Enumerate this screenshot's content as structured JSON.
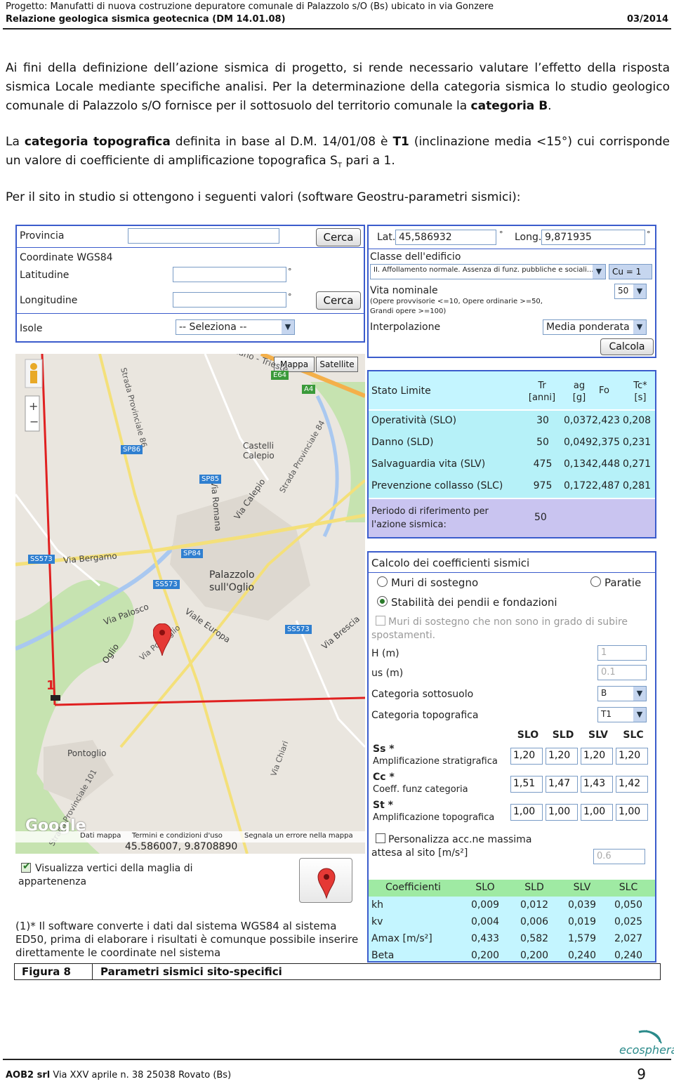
{
  "header": {
    "project": "Progetto: Manufatti di nuova costruzione depuratore comunale di Palazzolo s/O (Bs) ubicato in via Gonzere",
    "report": "Relazione geologica sismica geotecnica (DM 14.01.08)",
    "date": "03/2014"
  },
  "paragraphs": {
    "p1": "Ai fini della definizione dell’azione sismica di progetto, si rende necessario valutare l’effetto della risposta sismica  Locale mediante specifiche analisi. Per la determinazione della categoria sismica lo studio geologico comunale di Palazzolo s/O fornisce per il sottosuolo del territorio comunale la ",
    "p1_bold": "categoria B",
    "p1_end": ".",
    "p2_a": "La ",
    "p2_bold1": "categoria topografica",
    "p2_b": " definita in base al D.M. 14/01/08 è ",
    "p2_bold2": "T1",
    "p2_c": " (inclinazione media <15°) cui corrisponde un valore di coefficiente di amplificazione topografica S",
    "p2_sub": "T",
    "p2_d": " pari a 1.",
    "p3": "Per il sito in studio si ottengono i seguenti valori (software Geostru-parametri sismici):"
  },
  "search": {
    "provincia": "Provincia",
    "cerca": "Cerca",
    "coord": "Coordinate WGS84",
    "latitudine": "Latitudine",
    "longitudine": "Longitudine",
    "deg": "°",
    "isole": "Isole",
    "isole_sel": "-- Seleziona --"
  },
  "site": {
    "lat_label": "Lat.",
    "lat": "45,586932",
    "long_label": "Long.",
    "long": "9,871935",
    "deg": "°",
    "classe_label": "Classe dell'edificio",
    "classe_sel": "II. Affollamento normale. Assenza di funz. pubbliche e sociali...",
    "cu": "Cu = 1",
    "vita_label": "Vita nominale",
    "vita_note1": "(Opere provvisorie <=10, Opere ordinarie >=50,",
    "vita_note2": "Grandi opere >=100)",
    "vita_sel": "50",
    "interp_label": "Interpolazione",
    "interp_sel": "Media ponderata",
    "calcola": "Calcola"
  },
  "map": {
    "btn_mappa": "Mappa",
    "btn_sat": "Satellite",
    "coords": "45.586007, 9.8708890",
    "google": "Google",
    "dati": "Dati mappa",
    "termini": "Termini e condizioni d'uso",
    "segnala": "Segnala un errore nella mappa",
    "marker": "1",
    "places": {
      "castelli": "Castelli Calepio",
      "palazzolo": "Palazzolo sull'Oglio",
      "pontoglio": "Pontoglio",
      "bergamo": "Via Bergamo",
      "palosco": "Via Palosco",
      "europa": "Viale Europa",
      "brescia": "Via Brescia",
      "calepio": "Via Calepio",
      "romana": "Via Romana",
      "oglio": "Oglio",
      "milano_trieste": "Milano - Trieste",
      "sp86": "Strada Provinciale 86",
      "sp84": "Strada Provinciale 84",
      "sp101": "Strada Provinciale 101",
      "chiari": "Via Chiari",
      "pontoglio_via": "Via Pontoglio"
    },
    "shields": [
      "E64",
      "A4",
      "SP86",
      "SP85",
      "SP84",
      "SS573",
      "SS573",
      "SS573"
    ]
  },
  "visualizza": "Visualizza vertici della maglia di appartenenza",
  "footnote": "(1)* Il software converte i dati dal sistema WGS84 al sistema ED50, prima di elaborare i risultati è comunque possibile inserire direttamente le coordinate nel sistema",
  "limits": {
    "headers": [
      "Stato Limite",
      "Tr [anni]",
      "ag [g]",
      "Fo",
      "Tc* [s]"
    ],
    "rows": [
      [
        "Operatività (SLO)",
        "30",
        "0,037",
        "2,423",
        "0,208"
      ],
      [
        "Danno (SLD)",
        "50",
        "0,049",
        "2,375",
        "0,231"
      ],
      [
        "Salvaguardia vita (SLV)",
        "475",
        "0,134",
        "2,448",
        "0,271"
      ],
      [
        "Prevenzione collasso (SLC)",
        "975",
        "0,172",
        "2,487",
        "0,281"
      ]
    ],
    "periodo_label": "Periodo di riferimento per l'azione sismica:",
    "periodo": "50"
  },
  "coeff": {
    "title": "Calcolo dei coefficienti sismici",
    "muri": "Muri di sostegno",
    "paratie": "Paratie",
    "stab": "Stabilità dei pendii e fondazioni",
    "muri2": "Muri di sostegno che non sono in grado di subire spostamenti.",
    "h": "H (m)",
    "h_val": "1",
    "us": "us (m)",
    "us_val": "0.1",
    "cat_sott": "Categoria sottosuolo",
    "cat_sott_val": "B",
    "cat_top": "Categoria topografica",
    "cat_top_val": "T1",
    "cols": [
      "SLO",
      "SLD",
      "SLV",
      "SLC"
    ],
    "ss_label": "Ss *",
    "ss_desc": "Amplificazione stratigrafica",
    "ss": [
      "1,20",
      "1,20",
      "1,20",
      "1,20"
    ],
    "cc_label": "Cc *",
    "cc_desc": "Coeff. funz categoria",
    "cc": [
      "1,51",
      "1,47",
      "1,43",
      "1,42"
    ],
    "st_label": "St *",
    "st_desc": "Amplificazione topografica",
    "st": [
      "1,00",
      "1,00",
      "1,00",
      "1,00"
    ],
    "pers": "Personalizza acc.ne massima attesa al sito [m/s²]",
    "pers_val": "0.6",
    "tbl_headers": [
      "Coefficienti",
      "SLO",
      "SLD",
      "SLV",
      "SLC"
    ],
    "tbl": [
      [
        "kh",
        "0,009",
        "0,012",
        "0,039",
        "0,050"
      ],
      [
        "kv",
        "0,004",
        "0,006",
        "0,019",
        "0,025"
      ],
      [
        "Amax [m/s²]",
        "0,433",
        "0,582",
        "1,579",
        "2,027"
      ],
      [
        "Beta",
        "0,200",
        "0,200",
        "0,240",
        "0,240"
      ]
    ]
  },
  "caption": {
    "label": "Figura 8",
    "text": "Parametri sismici sito-specifici"
  },
  "footer": {
    "company": "AOB2 srl",
    "address": " Via XXV aprile n. 38 25038  Rovato (Bs)",
    "page": "9",
    "logo": "ecosphera"
  },
  "colors": {
    "panel_border": "#3b5ccc",
    "cyan": "#c4f5ff",
    "violet": "#c9c4f0",
    "green": "#9feaa3",
    "map_bg": "#eae6df",
    "road": "#f4e07a",
    "route": "#e02020"
  }
}
